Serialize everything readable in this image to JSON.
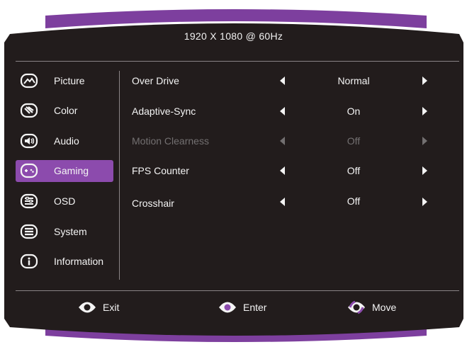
{
  "header": {
    "resolution": "1920  X  1080  @  60Hz"
  },
  "sidebar": {
    "items": [
      {
        "label": "Picture",
        "icon": "picture-icon"
      },
      {
        "label": "Color",
        "icon": "color-icon"
      },
      {
        "label": "Audio",
        "icon": "audio-icon"
      },
      {
        "label": "Gaming",
        "icon": "gaming-icon",
        "selected": true
      },
      {
        "label": "OSD",
        "icon": "osd-icon"
      },
      {
        "label": "System",
        "icon": "system-icon"
      },
      {
        "label": "Information",
        "icon": "information-icon"
      }
    ]
  },
  "settings": [
    {
      "name": "Over Drive",
      "value": "Normal",
      "enabled": true
    },
    {
      "name": "Adaptive-Sync",
      "value": "On",
      "enabled": true
    },
    {
      "name": "Motion Clearness",
      "value": "Off",
      "enabled": false
    },
    {
      "name": "FPS Counter",
      "value": "Off",
      "enabled": true
    },
    {
      "name": "Crosshair",
      "value": "Off",
      "enabled": true
    }
  ],
  "footer": {
    "exit_label": "Exit",
    "enter_label": "Enter",
    "move_label": "Move"
  },
  "colors": {
    "background": "#221c1c",
    "accent": "#8c4bad",
    "text": "#f4f4f4",
    "disabled_text": "#737071"
  }
}
